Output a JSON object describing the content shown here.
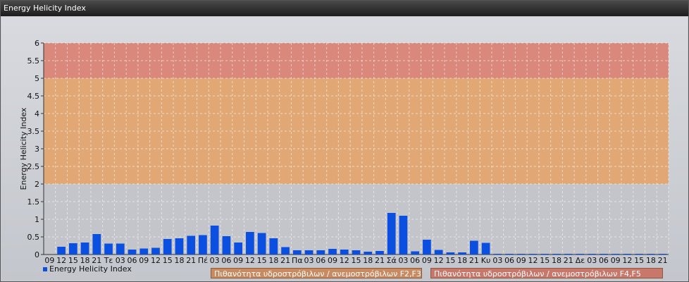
{
  "window": {
    "title": "Energy Helicity Index"
  },
  "chart_data": {
    "type": "bar",
    "title": "",
    "ylabel": "Energy Helicity Index",
    "xlabel": "",
    "ylim": [
      0,
      6
    ],
    "yticks": [
      "0",
      "0.5",
      "1",
      "1.5",
      "2",
      "2.5",
      "3",
      "3.5",
      "4",
      "4.5",
      "5",
      "5.5",
      "6"
    ],
    "grid": true,
    "categories": [
      "09",
      "12",
      "15",
      "18",
      "21",
      "Τε",
      "03",
      "06",
      "09",
      "12",
      "15",
      "18",
      "21",
      "Πέ",
      "03",
      "06",
      "09",
      "12",
      "15",
      "18",
      "21",
      "Πα",
      "03",
      "06",
      "09",
      "12",
      "15",
      "18",
      "21",
      "Σά",
      "03",
      "06",
      "09",
      "12",
      "15",
      "18",
      "21",
      "Κυ",
      "03",
      "06",
      "09",
      "12",
      "15",
      "18",
      "21",
      "Δε",
      "03",
      "06",
      "09",
      "12",
      "15",
      "18",
      "21"
    ],
    "series": [
      {
        "name": "Energy Helicity Index",
        "color": "#0b4fe0",
        "values": [
          0.0,
          0.22,
          0.32,
          0.34,
          0.58,
          0.31,
          0.31,
          0.14,
          0.17,
          0.19,
          0.44,
          0.46,
          0.53,
          0.55,
          0.82,
          0.52,
          0.34,
          0.64,
          0.61,
          0.46,
          0.21,
          0.12,
          0.12,
          0.12,
          0.16,
          0.14,
          0.12,
          0.08,
          0.1,
          1.18,
          1.1,
          0.09,
          0.42,
          0.13,
          0.06,
          0.06,
          0.39,
          0.33,
          0.02,
          0.02,
          0.02,
          0.02,
          0.02,
          0.02,
          0.02,
          0.02,
          0.02,
          0.02,
          0.02,
          0.02,
          0.02,
          0.02,
          0.02
        ]
      }
    ],
    "bands": [
      {
        "from": 2,
        "to": 5,
        "color": "#e8a060",
        "label": "Πιθανότητα υδροστρόβιλων / ανεμοστρόβιλων F2,F3"
      },
      {
        "from": 5,
        "to": 6,
        "color": "#e07868",
        "label": "Πιθανότητα υδροστρόβιλων / ανεμοστρόβιλων F4,F5"
      }
    ],
    "legend": "bottom-left"
  }
}
